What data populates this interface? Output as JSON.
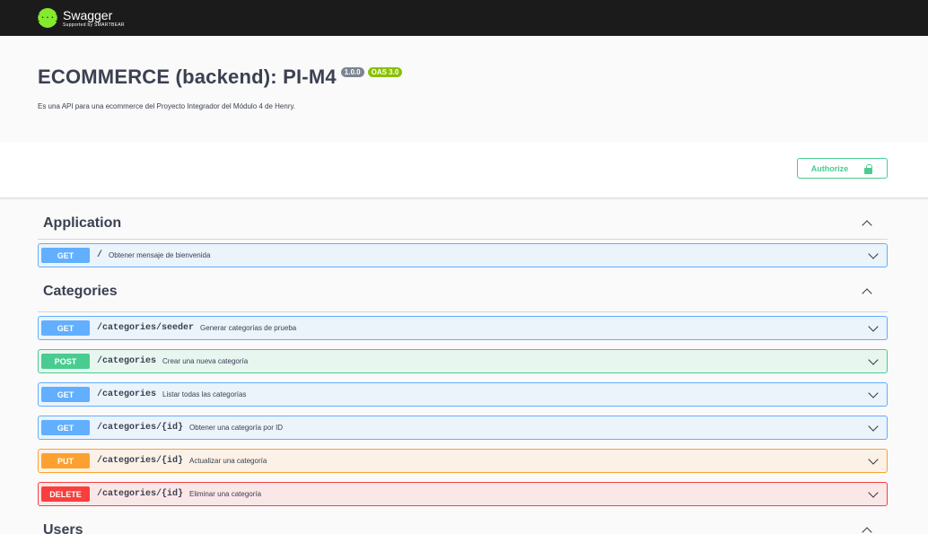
{
  "header": {
    "logo_symbol": "{···}",
    "brand": "Swagger",
    "brand_sub": "Supported by SMARTBEAR"
  },
  "info": {
    "title": "ECOMMERCE (backend): PI-M4",
    "version_badge": "1.0.0",
    "oas_badge": "OAS 3.0",
    "description": "Es una API para una ecommerce del Proyecto Integrador del Módulo 4 de Henry."
  },
  "auth": {
    "authorize_label": "Authorize",
    "icon": "lock-icon"
  },
  "colors": {
    "get": "#61affe",
    "post": "#49cc90",
    "put": "#fca130",
    "delete": "#f93e3e"
  },
  "sections": [
    {
      "name": "Application",
      "operations": [
        {
          "method": "GET",
          "path": "/",
          "summary": "Obtener mensaje de bienvenida"
        }
      ]
    },
    {
      "name": "Categories",
      "operations": [
        {
          "method": "GET",
          "path": "/categories/seeder",
          "summary": "Generar categorías de prueba"
        },
        {
          "method": "POST",
          "path": "/categories",
          "summary": "Crear una nueva categoría"
        },
        {
          "method": "GET",
          "path": "/categories",
          "summary": "Listar todas las categorías"
        },
        {
          "method": "GET",
          "path": "/categories/{id}",
          "summary": "Obtener una categoría por ID"
        },
        {
          "method": "PUT",
          "path": "/categories/{id}",
          "summary": "Actualizar una categoría"
        },
        {
          "method": "DELETE",
          "path": "/categories/{id}",
          "summary": "Eliminar una categoría"
        }
      ]
    },
    {
      "name": "Users",
      "operations": []
    }
  ]
}
